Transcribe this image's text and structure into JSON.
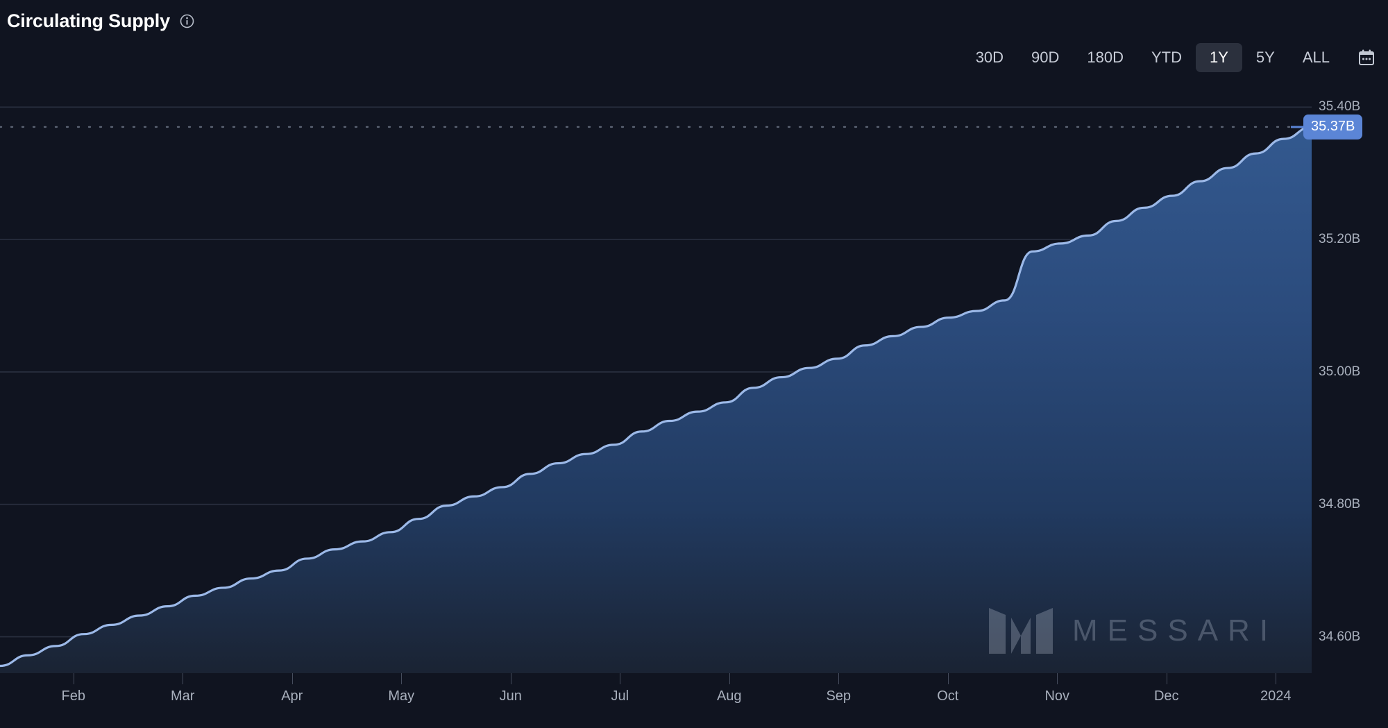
{
  "header": {
    "title": "Circulating Supply",
    "info_icon": "info-icon"
  },
  "range_selector": {
    "options": [
      {
        "label": "30D",
        "active": false
      },
      {
        "label": "90D",
        "active": false
      },
      {
        "label": "180D",
        "active": false
      },
      {
        "label": "YTD",
        "active": false
      },
      {
        "label": "1Y",
        "active": true
      },
      {
        "label": "5Y",
        "active": false
      },
      {
        "label": "ALL",
        "active": false
      }
    ],
    "calendar_icon": "calendar-icon"
  },
  "current_value": {
    "label": "35.37B",
    "badge_color": "#5b85d6"
  },
  "watermark": {
    "text": "MESSARI",
    "mark": "messari-logo-mark"
  },
  "colors": {
    "background": "#101420",
    "line": "#9cb9e8",
    "area_top": "#2f5486",
    "area_bottom": "#1a2231",
    "gridline": "#2a3040",
    "axis_text": "#a9b0bd",
    "active_tab_bg": "#2b303d"
  },
  "chart_data": {
    "type": "area",
    "title": "Circulating Supply",
    "xlabel": "",
    "ylabel": "",
    "ylim": [
      34.545,
      35.415
    ],
    "yticks": [
      35.4,
      35.2,
      35.0,
      34.8,
      34.6
    ],
    "ytick_labels": [
      "35.40B",
      "35.20B",
      "35.00B",
      "34.80B",
      "34.60B"
    ],
    "xtick_labels": [
      "Feb",
      "Mar",
      "Apr",
      "May",
      "Jun",
      "Jul",
      "Aug",
      "Sep",
      "Oct",
      "Nov",
      "Dec",
      "2024"
    ],
    "grid": true,
    "legend": null,
    "units": "B",
    "reference_line": {
      "value": 35.37,
      "style": "dotted",
      "label": "35.37B"
    },
    "series": [
      {
        "name": "Circulating Supply",
        "x": [
          "2023-01-10",
          "2023-01-17",
          "2023-01-24",
          "2023-02-01",
          "2023-02-08",
          "2023-02-15",
          "2023-02-22",
          "2023-03-01",
          "2023-03-08",
          "2023-03-15",
          "2023-03-22",
          "2023-04-01",
          "2023-04-08",
          "2023-04-15",
          "2023-04-22",
          "2023-05-01",
          "2023-05-08",
          "2023-05-15",
          "2023-05-22",
          "2023-06-01",
          "2023-06-08",
          "2023-06-15",
          "2023-06-22",
          "2023-07-01",
          "2023-07-08",
          "2023-07-15",
          "2023-07-22",
          "2023-08-01",
          "2023-08-08",
          "2023-08-15",
          "2023-08-22",
          "2023-09-01",
          "2023-09-08",
          "2023-09-15",
          "2023-09-22",
          "2023-09-28",
          "2023-10-02",
          "2023-10-06",
          "2023-10-12",
          "2023-10-20",
          "2023-11-01",
          "2023-11-10",
          "2023-11-20",
          "2023-12-01",
          "2023-12-10",
          "2023-12-20",
          "2023-12-28",
          "2024-01-05"
        ],
        "values": [
          34.556,
          34.572,
          34.586,
          34.604,
          34.618,
          34.632,
          34.646,
          34.662,
          34.674,
          34.688,
          34.7,
          34.718,
          34.732,
          34.744,
          34.758,
          34.778,
          34.798,
          34.812,
          34.826,
          34.846,
          34.862,
          34.876,
          34.89,
          34.91,
          34.926,
          34.94,
          34.954,
          34.976,
          34.992,
          35.006,
          35.02,
          35.04,
          35.054,
          35.068,
          35.082,
          35.092,
          35.108,
          35.182,
          35.194,
          35.206,
          35.228,
          35.248,
          35.266,
          35.288,
          35.308,
          35.33,
          35.352,
          35.37
        ]
      }
    ]
  }
}
